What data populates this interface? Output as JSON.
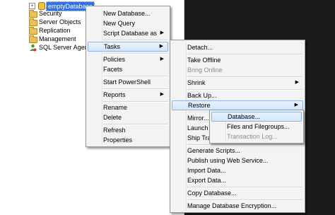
{
  "explorer": {
    "root_label": "emptyDatabase",
    "nodes": [
      {
        "label": "Security"
      },
      {
        "label": "Server Objects"
      },
      {
        "label": "Replication"
      },
      {
        "label": "Management"
      },
      {
        "label": "SQL Server Agent"
      }
    ],
    "expander_glyph": "+"
  },
  "context_menu": {
    "items": [
      {
        "label": "New Database..."
      },
      {
        "label": "New Query"
      },
      {
        "label": "Script Database as",
        "submenu": true
      },
      {
        "label": "Tasks",
        "submenu": true,
        "highlighted": true
      },
      {
        "label": "Policies",
        "submenu": true
      },
      {
        "label": "Facets"
      },
      {
        "label": "Start PowerShell"
      },
      {
        "label": "Reports",
        "submenu": true
      },
      {
        "label": "Rename"
      },
      {
        "label": "Delete"
      },
      {
        "label": "Refresh"
      },
      {
        "label": "Properties"
      }
    ]
  },
  "tasks_menu": {
    "items": [
      {
        "label": "Detach..."
      },
      {
        "label": "Take Offline"
      },
      {
        "label": "Bring Online",
        "disabled": true
      },
      {
        "label": "Shrink",
        "submenu": true
      },
      {
        "label": "Back Up..."
      },
      {
        "label": "Restore",
        "submenu": true,
        "highlighted": true
      },
      {
        "label": "Mirror..."
      },
      {
        "label": "Launch"
      },
      {
        "label": "Ship Tra"
      },
      {
        "label": "Generate Scripts..."
      },
      {
        "label": "Publish using Web Service..."
      },
      {
        "label": "Import Data..."
      },
      {
        "label": "Export Data..."
      },
      {
        "label": "Copy Database..."
      },
      {
        "label": "Manage Database Encryption..."
      }
    ]
  },
  "restore_menu": {
    "items": [
      {
        "label": "Database...",
        "highlighted": true
      },
      {
        "label": "Files and Filegroups..."
      },
      {
        "label": "Transaction Log...",
        "disabled": true
      }
    ]
  },
  "submenu_arrow": "▶",
  "colors": {
    "selection": "#3a6fd8",
    "menu_background": "#f3f3f3",
    "highlight_border": "#8db2e3",
    "background": "#1b1b1b"
  }
}
